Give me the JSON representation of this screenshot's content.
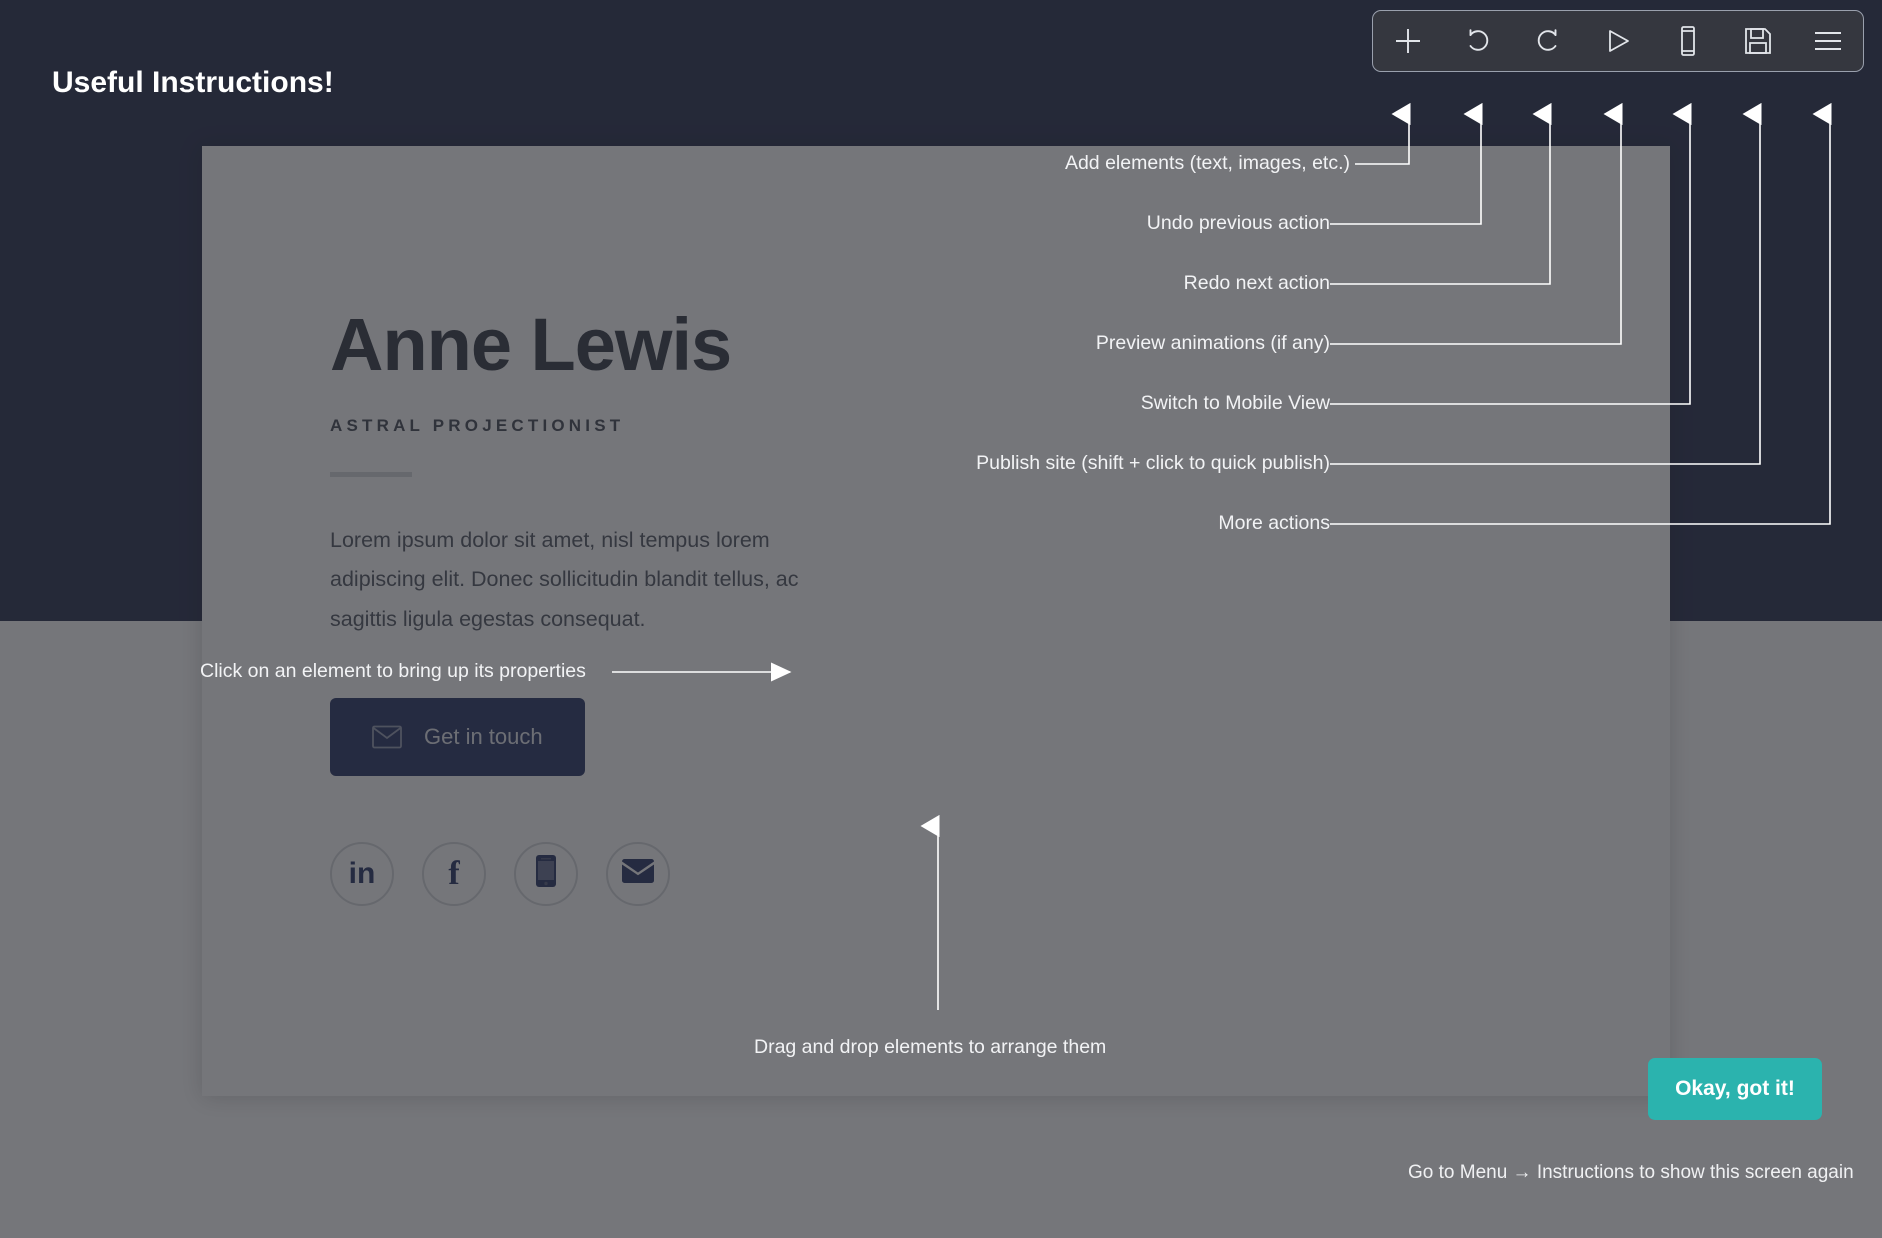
{
  "overlay": {
    "title": "Useful Instructions!",
    "dismiss_label": "Okay, got it!",
    "footer_note": "Go to Menu → Instructions to show this screen again"
  },
  "toolbar": {
    "buttons": [
      {
        "name": "add-element",
        "icon": "plus-icon",
        "annotation": "Add elements (text, images, etc.)"
      },
      {
        "name": "undo",
        "icon": "undo-icon",
        "annotation": "Undo previous action"
      },
      {
        "name": "redo",
        "icon": "redo-icon",
        "annotation": "Redo next action"
      },
      {
        "name": "preview",
        "icon": "play-icon",
        "annotation": "Preview animations (if any)"
      },
      {
        "name": "mobile-view",
        "icon": "mobile-icon",
        "annotation": "Switch to Mobile View"
      },
      {
        "name": "publish",
        "icon": "save-icon",
        "annotation": "Publish site (shift + click to quick publish)"
      },
      {
        "name": "more-actions",
        "icon": "hamburger-icon",
        "annotation": "More actions"
      }
    ]
  },
  "annotations": {
    "click_element": "Click on an element to bring up its properties",
    "drag_drop": "Drag and drop elements to arrange them"
  },
  "site": {
    "name": "Anne Lewis",
    "role": "ASTRAL PROJECTIONIST",
    "bio": "Lorem ipsum dolor sit amet, nisl tempus lorem adipiscing elit. Donec sollicitudin blandit tellus, ac sagittis ligula egestas consequat.",
    "cta_label": "Get in touch",
    "social": [
      {
        "name": "linkedin",
        "icon": "linkedin-icon",
        "glyph": "in"
      },
      {
        "name": "facebook",
        "icon": "facebook-icon",
        "glyph": "f"
      },
      {
        "name": "phone",
        "icon": "mobile-phone-icon",
        "glyph": ""
      },
      {
        "name": "email",
        "icon": "envelope-icon",
        "glyph": ""
      }
    ]
  },
  "colors": {
    "brand_navy": "#2e3552",
    "accent_teal": "#2bb3ae",
    "cta_navy": "#2e3a6b",
    "toolbar_bg": "#35373f"
  }
}
